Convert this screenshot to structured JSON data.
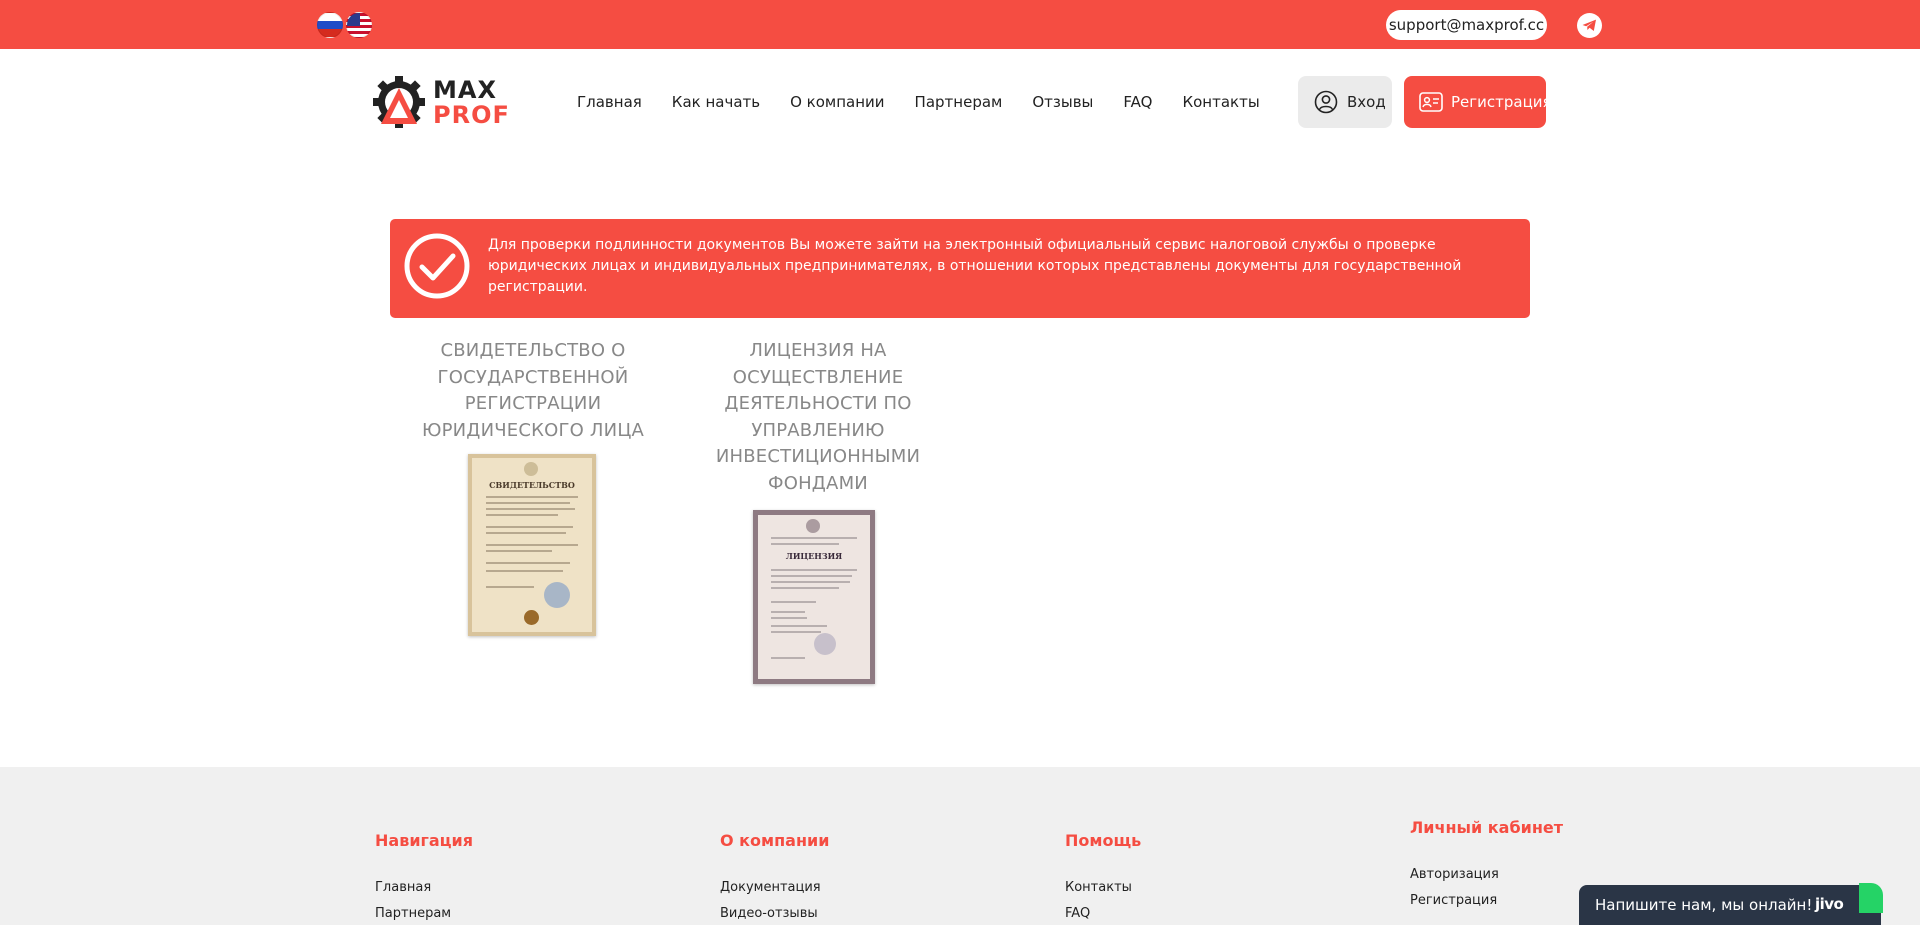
{
  "topbar": {
    "languages": [
      {
        "code": "ru",
        "icon": "russia-flag-icon"
      },
      {
        "code": "en",
        "icon": "usa-flag-icon"
      }
    ],
    "email": "support@maxprof.cc",
    "telegram_icon": "telegram-icon"
  },
  "logo": {
    "line1": "MAX",
    "line2": "PROF"
  },
  "nav": {
    "items": [
      "Главная",
      "Как начать",
      "О компании",
      "Партнерам",
      "Отзывы",
      "FAQ",
      "Контакты"
    ]
  },
  "auth": {
    "login_label": "Вход",
    "register_label": "Регистрация"
  },
  "notice": {
    "text": "Для проверки подлинности документов Вы можете зайти на электронный официальный сервис налоговой службы о проверке юридических лицах и индивидуальных предпринимателях, в отношении которых представлены документы для государственной регистрации.",
    "icon": "check-circle-icon"
  },
  "documents": [
    {
      "title": "Свидетельство о государственной регистрации юридического лица",
      "heading": "СВИДЕТЕЛЬСТВО"
    },
    {
      "title": "Лицензия на осуществление деятельности по управлению инвестиционными фондами",
      "heading": "ЛИЦЕНЗИЯ"
    }
  ],
  "footer": {
    "columns": [
      {
        "title": "Навигация",
        "links": [
          "Главная",
          "Партнерам"
        ]
      },
      {
        "title": "О компании",
        "links": [
          "Документация",
          "Видео-отзывы"
        ]
      },
      {
        "title": "Помощь",
        "links": [
          "Контакты",
          "FAQ"
        ]
      },
      {
        "title": "Личный кабинет",
        "links": [
          "Авторизация",
          "Регистрация"
        ]
      }
    ]
  },
  "chat": {
    "message": "Напишите нам, мы онлайн!",
    "brand": "jivo"
  },
  "colors": {
    "accent": "#f54d42",
    "footer_bg": "#f0f0f0",
    "chat_bg": "#2a3546"
  }
}
